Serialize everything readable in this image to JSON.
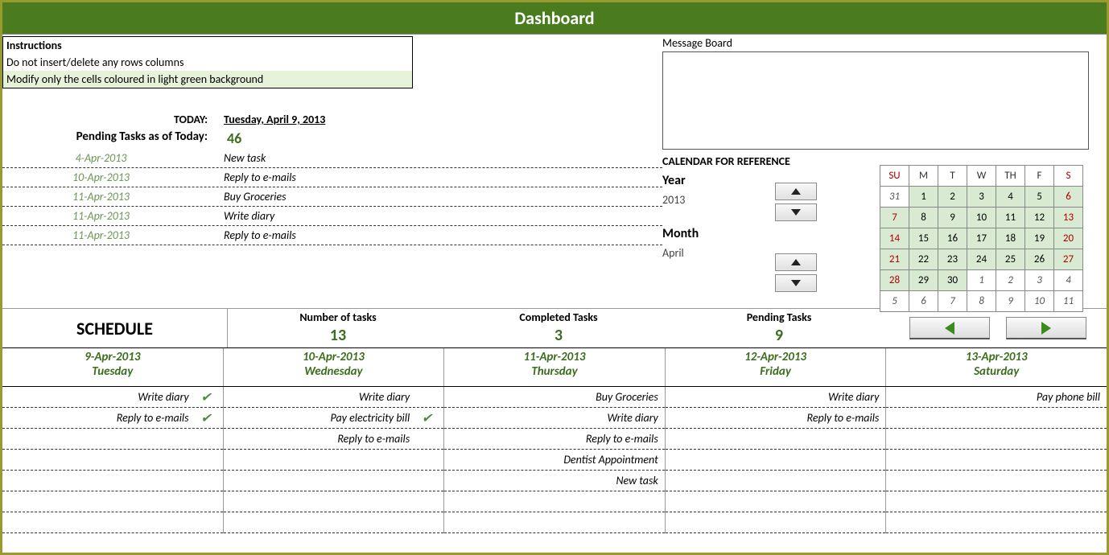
{
  "title": "Dashboard",
  "instructions": {
    "header": "Instructions",
    "line1": "Do not insert/delete any rows columns",
    "line2": "Modify only the cells coloured in light green background"
  },
  "today": {
    "label": "TODAY:",
    "value": "Tuesday, April 9, 2013"
  },
  "pending_today": {
    "label": "Pending Tasks as of Today:",
    "value": "46"
  },
  "upcoming": [
    {
      "date": "4-Apr-2013",
      "task": "New task"
    },
    {
      "date": "10-Apr-2013",
      "task": "Reply to e-mails"
    },
    {
      "date": "11-Apr-2013",
      "task": "Buy Groceries"
    },
    {
      "date": "11-Apr-2013",
      "task": "Write diary"
    },
    {
      "date": "11-Apr-2013",
      "task": "Reply to e-mails"
    }
  ],
  "message_board": {
    "label": "Message Board"
  },
  "calendar_ref": {
    "title": "CALENDAR FOR REFERENCE",
    "year_label": "Year",
    "year_value": "2013",
    "month_label": "Month",
    "month_value": "April"
  },
  "mini_calendar": {
    "headers": [
      "SU",
      "M",
      "T",
      "W",
      "TH",
      "F",
      "S"
    ],
    "rows": [
      [
        {
          "v": "31",
          "c": "out sun"
        },
        {
          "v": "1",
          "c": "in"
        },
        {
          "v": "2",
          "c": "in"
        },
        {
          "v": "3",
          "c": "in"
        },
        {
          "v": "4",
          "c": "in"
        },
        {
          "v": "5",
          "c": "in"
        },
        {
          "v": "6",
          "c": "in sat"
        }
      ],
      [
        {
          "v": "7",
          "c": "in sun"
        },
        {
          "v": "8",
          "c": "in"
        },
        {
          "v": "9",
          "c": "in"
        },
        {
          "v": "10",
          "c": "in"
        },
        {
          "v": "11",
          "c": "in"
        },
        {
          "v": "12",
          "c": "in"
        },
        {
          "v": "13",
          "c": "in sat"
        }
      ],
      [
        {
          "v": "14",
          "c": "in sun"
        },
        {
          "v": "15",
          "c": "in"
        },
        {
          "v": "16",
          "c": "in"
        },
        {
          "v": "17",
          "c": "in"
        },
        {
          "v": "18",
          "c": "in"
        },
        {
          "v": "19",
          "c": "in"
        },
        {
          "v": "20",
          "c": "in sat"
        }
      ],
      [
        {
          "v": "21",
          "c": "in sun"
        },
        {
          "v": "22",
          "c": "in"
        },
        {
          "v": "23",
          "c": "in"
        },
        {
          "v": "24",
          "c": "in"
        },
        {
          "v": "25",
          "c": "in"
        },
        {
          "v": "26",
          "c": "in"
        },
        {
          "v": "27",
          "c": "in sat"
        }
      ],
      [
        {
          "v": "28",
          "c": "in sun"
        },
        {
          "v": "29",
          "c": "in"
        },
        {
          "v": "30",
          "c": "in"
        },
        {
          "v": "1",
          "c": "out"
        },
        {
          "v": "2",
          "c": "out"
        },
        {
          "v": "3",
          "c": "out"
        },
        {
          "v": "4",
          "c": "out sat"
        }
      ],
      [
        {
          "v": "5",
          "c": "out sun"
        },
        {
          "v": "6",
          "c": "out"
        },
        {
          "v": "7",
          "c": "out"
        },
        {
          "v": "8",
          "c": "out"
        },
        {
          "v": "9",
          "c": "out"
        },
        {
          "v": "10",
          "c": "out"
        },
        {
          "v": "11",
          "c": "out sat"
        }
      ]
    ]
  },
  "schedule_header": "SCHEDULE",
  "stats": {
    "num_tasks": {
      "label": "Number of tasks",
      "value": "13"
    },
    "completed": {
      "label": "Completed Tasks",
      "value": "3"
    },
    "pending": {
      "label": "Pending Tasks",
      "value": "9"
    }
  },
  "days": [
    {
      "date": "9-Apr-2013",
      "name": "Tuesday",
      "tasks": [
        {
          "t": "Write diary",
          "done": true
        },
        {
          "t": "Reply to e-mails",
          "done": true
        },
        {
          "t": ""
        },
        {
          "t": ""
        },
        {
          "t": ""
        },
        {
          "t": ""
        },
        {
          "t": ""
        }
      ]
    },
    {
      "date": "10-Apr-2013",
      "name": "Wednesday",
      "tasks": [
        {
          "t": "Write diary"
        },
        {
          "t": "Pay electricity bill",
          "done": true
        },
        {
          "t": "Reply to e-mails"
        },
        {
          "t": ""
        },
        {
          "t": ""
        },
        {
          "t": ""
        },
        {
          "t": ""
        }
      ]
    },
    {
      "date": "11-Apr-2013",
      "name": "Thursday",
      "tasks": [
        {
          "t": "Buy Groceries"
        },
        {
          "t": "Write diary"
        },
        {
          "t": "Reply to e-mails"
        },
        {
          "t": "Dentist Appointment"
        },
        {
          "t": "New task"
        },
        {
          "t": ""
        },
        {
          "t": ""
        }
      ]
    },
    {
      "date": "12-Apr-2013",
      "name": "Friday",
      "tasks": [
        {
          "t": "Write diary"
        },
        {
          "t": "Reply to e-mails"
        },
        {
          "t": ""
        },
        {
          "t": ""
        },
        {
          "t": ""
        },
        {
          "t": ""
        },
        {
          "t": ""
        }
      ]
    },
    {
      "date": "13-Apr-2013",
      "name": "Saturday",
      "tasks": [
        {
          "t": "Pay phone bill"
        },
        {
          "t": ""
        },
        {
          "t": ""
        },
        {
          "t": ""
        },
        {
          "t": ""
        },
        {
          "t": ""
        },
        {
          "t": ""
        }
      ]
    }
  ]
}
